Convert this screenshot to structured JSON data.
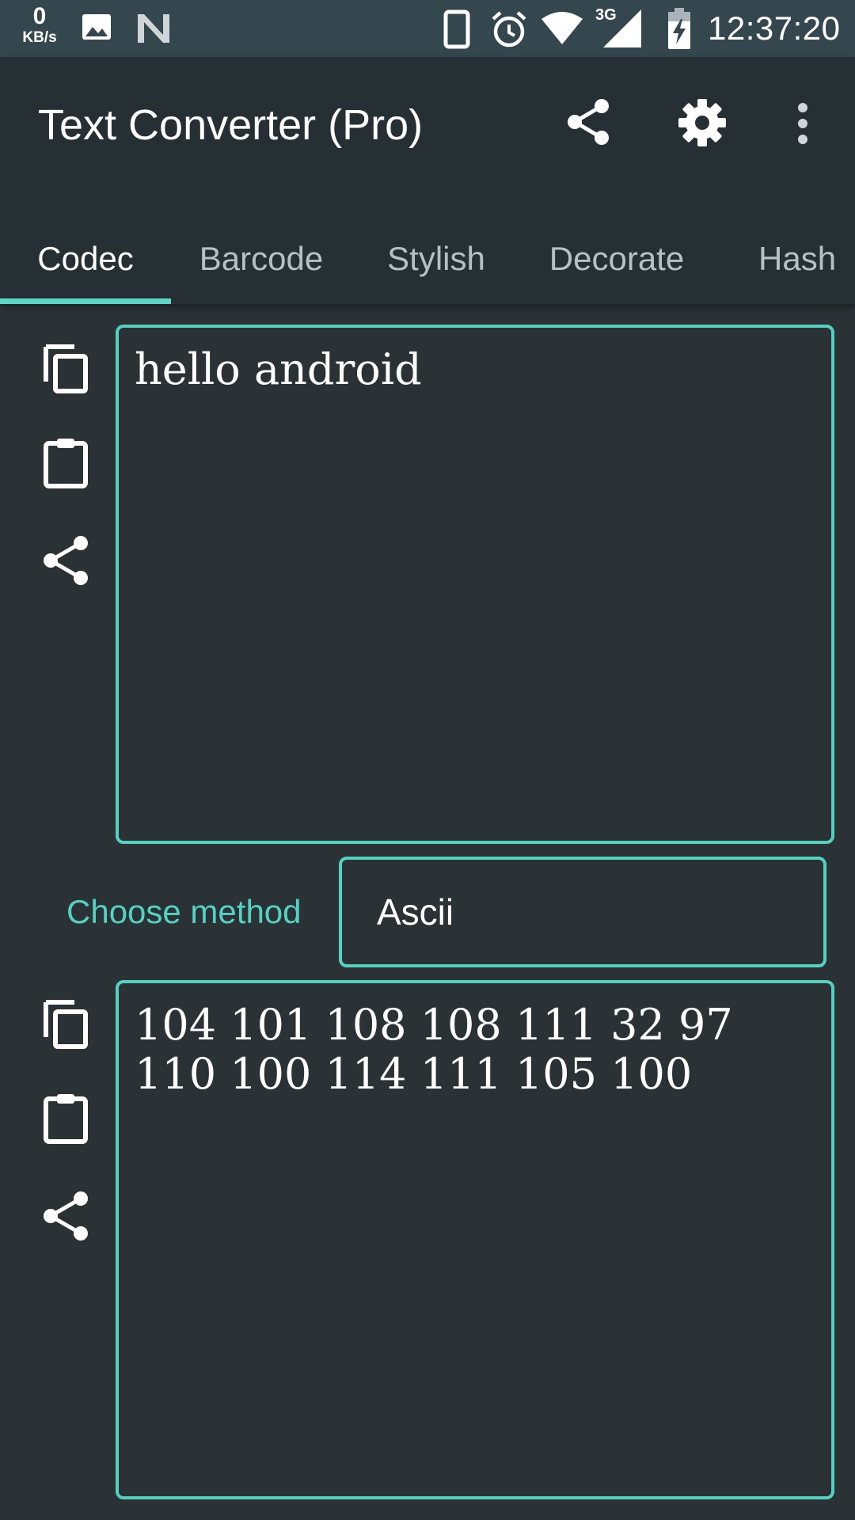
{
  "status_bar": {
    "net_speed_value": "0",
    "net_speed_unit": "KB/s",
    "network_type": "3G",
    "time": "12:37:20"
  },
  "app_bar": {
    "title": "Text Converter (Pro)"
  },
  "tabs": [
    {
      "label": "Codec",
      "active": true
    },
    {
      "label": "Barcode",
      "active": false
    },
    {
      "label": "Stylish",
      "active": false
    },
    {
      "label": "Decorate",
      "active": false
    },
    {
      "label": "Hash",
      "active": false
    }
  ],
  "input": {
    "value": "hello android"
  },
  "method": {
    "label": "Choose method",
    "selected": "Ascii"
  },
  "output": {
    "value": "104 101 108 108 111 32 97\n110 100 114 111 105 100"
  },
  "colors": {
    "accent": "#55d1c4",
    "app_bar": "#263034",
    "status_bar": "#34464e",
    "background": "#2b3235"
  }
}
